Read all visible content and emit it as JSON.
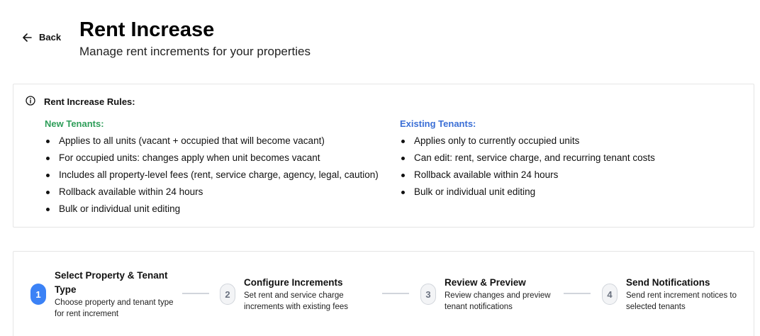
{
  "header": {
    "back_label": "Back",
    "title": "Rent Increase",
    "subtitle": "Manage rent increments for your properties"
  },
  "rules": {
    "heading": "Rent Increase Rules:",
    "icon": "info-circle-icon",
    "new_tenants": {
      "heading": "New Tenants:",
      "color": "#2f9e5a",
      "items": [
        "Applies to all units (vacant + occupied that will become vacant)",
        "For occupied units: changes apply when unit becomes vacant",
        "Includes all property-level fees (rent, service charge, agency, legal, caution)",
        "Rollback available within 24 hours",
        "Bulk or individual unit editing"
      ]
    },
    "existing_tenants": {
      "heading": "Existing Tenants:",
      "color": "#3b6fd6",
      "items": [
        "Applies only to currently occupied units",
        "Can edit: rent, service charge, and recurring tenant costs",
        "Rollback available within 24 hours",
        "Bulk or individual unit editing"
      ]
    }
  },
  "stepper": {
    "active_color": "#3b82f6",
    "steps": [
      {
        "number": "1",
        "title": "Select Property & Tenant Type",
        "description": "Choose property and tenant type for rent increment",
        "active": true
      },
      {
        "number": "2",
        "title": "Configure Increments",
        "description": "Set rent and service charge increments with existing fees",
        "active": false
      },
      {
        "number": "3",
        "title": "Review & Preview",
        "description": "Review changes and preview tenant notifications",
        "active": false
      },
      {
        "number": "4",
        "title": "Send Notifications",
        "description": "Send rent increment notices to selected tenants",
        "active": false
      }
    ]
  }
}
